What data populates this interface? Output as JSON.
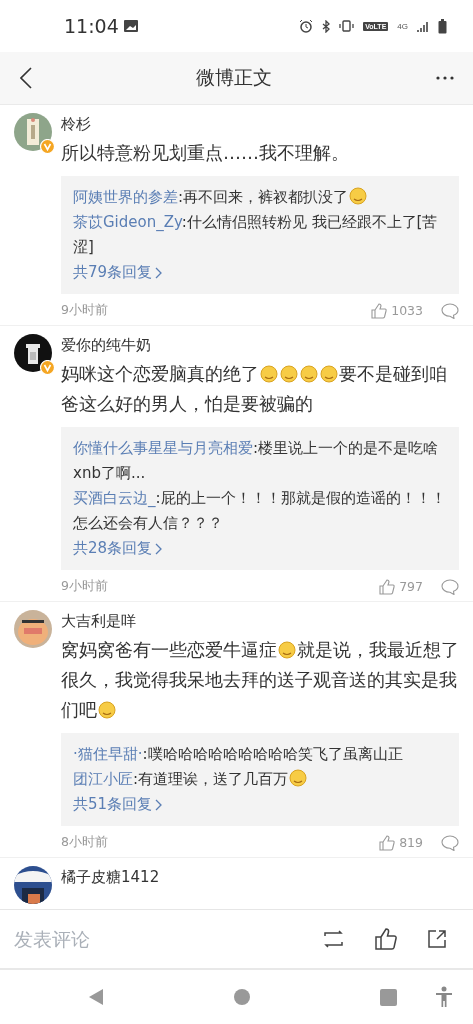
{
  "status_bar": {
    "time": "11:04",
    "volte": "VoLTE",
    "network": "4G"
  },
  "header": {
    "title": "微博正文"
  },
  "comments": [
    {
      "user": "柃杉",
      "verified": true,
      "avatar": {
        "kind": "picture"
      },
      "text": [
        {
          "kind": "text",
          "text": "所以特意粉见划重点……我不理解。"
        }
      ],
      "replies": [
        {
          "user": "阿姨世界的参差",
          "text": [
            {
              "kind": "text",
              "text": ":再不回来，裤衩都扒没了"
            },
            {
              "kind": "emoji"
            }
          ]
        },
        {
          "user": "茶苡Gideon_Zy",
          "text": [
            {
              "kind": "text",
              "text": ":什么情侣照转粉见 我已经跟不上了[苦涩]"
            }
          ]
        }
      ],
      "more": "共79条回复",
      "time": "9小时前",
      "likes": "1033"
    },
    {
      "user": "爱你的纯牛奶",
      "verified": true,
      "avatar": {
        "kind": "picture"
      },
      "text": [
        {
          "kind": "text",
          "text": "妈咪这个恋爱脑真的绝了"
        },
        {
          "kind": "emoji"
        },
        {
          "kind": "emoji"
        },
        {
          "kind": "emoji"
        },
        {
          "kind": "emoji"
        },
        {
          "kind": "text",
          "text": "要不是碰到咱爸这么好的男人，怕是要被骗的"
        }
      ],
      "replies": [
        {
          "user": "你懂什么事星星与月亮相爱",
          "text": [
            {
              "kind": "text",
              "text": ":楼里说上一个的是不是吃啥xnb了啊..."
            }
          ]
        },
        {
          "user": "买酒白云边_",
          "text": [
            {
              "kind": "text",
              "text": ":屁的上一个！！！那就是假的造谣的！！！怎么还会有人信？？？"
            }
          ]
        }
      ],
      "more": "共28条回复",
      "time": "9小时前",
      "likes": "797"
    },
    {
      "user": "大吉利是咩",
      "verified": false,
      "avatar": {
        "kind": "picture"
      },
      "text": [
        {
          "kind": "text",
          "text": "窝妈窝爸有一些恋爱牛逼症"
        },
        {
          "kind": "emoji"
        },
        {
          "kind": "text",
          "text": "就是说，我最近想了很久，我觉得我呆地去拜的送子观音送的其实是我们吧"
        },
        {
          "kind": "emoji"
        }
      ],
      "replies": [
        {
          "user": "·猫住早甜·",
          "text": [
            {
              "kind": "text",
              "text": ":噗哈哈哈哈哈哈哈哈哈笑飞了虽离山正"
            }
          ]
        },
        {
          "user": "团江小匠",
          "text": [
            {
              "kind": "text",
              "text": ":有道理诶，送了几百万"
            },
            {
              "kind": "emoji"
            }
          ]
        }
      ],
      "more": "共51条回复",
      "time": "8小时前",
      "likes": "819"
    },
    {
      "user": "橘子皮糖1412",
      "avatar": {
        "kind": "picture"
      }
    }
  ],
  "composer": {
    "placeholder": "发表评论"
  }
}
